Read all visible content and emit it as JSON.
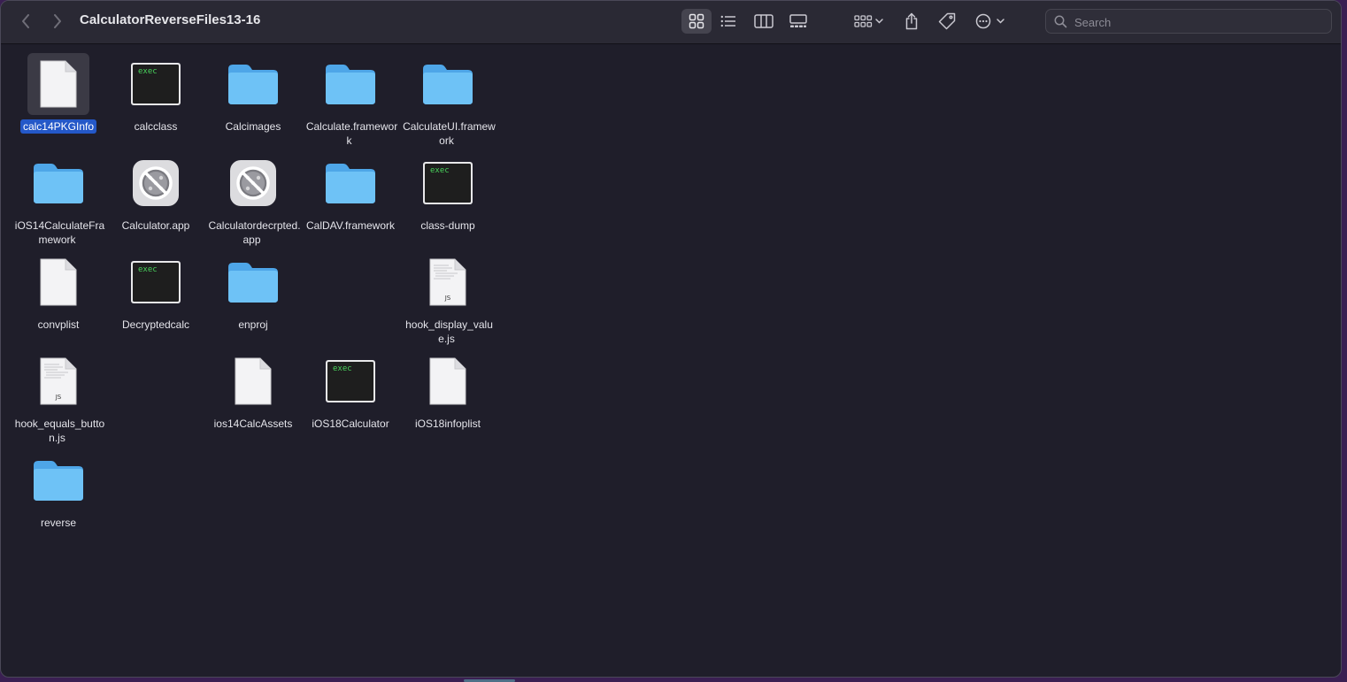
{
  "window": {
    "title": "CalculatorReverseFiles13-16"
  },
  "search": {
    "placeholder": "Search"
  },
  "files": [
    {
      "name": "calc14PKGInfo",
      "kind": "doc",
      "col": 0,
      "row": 0,
      "selected": true
    },
    {
      "name": "calcclass",
      "kind": "exec",
      "col": 1,
      "row": 0
    },
    {
      "name": "Calcimages",
      "kind": "folder",
      "col": 2,
      "row": 0
    },
    {
      "name": "Calculate.framework",
      "kind": "folder",
      "col": 3,
      "row": 0
    },
    {
      "name": "CalculateUI.framework",
      "kind": "folder",
      "col": 4,
      "row": 0
    },
    {
      "name": "iOS14CalculateFramework",
      "kind": "folder",
      "col": 0,
      "row": 1
    },
    {
      "name": "Calculator.app",
      "kind": "app",
      "col": 1,
      "row": 1
    },
    {
      "name": "Calculatordecrpted.app",
      "kind": "app",
      "col": 2,
      "row": 1
    },
    {
      "name": "CalDAV.framework",
      "kind": "folder",
      "col": 3,
      "row": 1
    },
    {
      "name": "class-dump",
      "kind": "exec",
      "col": 4,
      "row": 1
    },
    {
      "name": "convplist",
      "kind": "doc",
      "col": 0,
      "row": 2
    },
    {
      "name": "Decryptedcalc",
      "kind": "exec",
      "col": 1,
      "row": 2
    },
    {
      "name": "enproj",
      "kind": "folder",
      "col": 2,
      "row": 2
    },
    {
      "name": "hook_display_value.js",
      "kind": "js",
      "col": 4,
      "row": 2
    },
    {
      "name": "hook_equals_button.js",
      "kind": "js",
      "col": 0,
      "row": 3
    },
    {
      "name": "ios14CalcAssets",
      "kind": "doc",
      "col": 2,
      "row": 3
    },
    {
      "name": "iOS18Calculator",
      "kind": "exec",
      "col": 3,
      "row": 3
    },
    {
      "name": "iOS18infoplist",
      "kind": "doc",
      "col": 4,
      "row": 3
    },
    {
      "name": "reverse",
      "kind": "folder",
      "col": 0,
      "row": 4
    }
  ],
  "icon_text": {
    "exec": "exec",
    "js": "JS"
  }
}
